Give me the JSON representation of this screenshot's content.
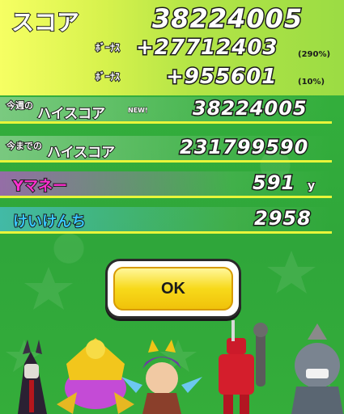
{
  "score": {
    "label": "スコア",
    "total": "38224005",
    "bonus1_label": "ﾎﾞｰﾅｽ",
    "bonus1_value": "+27712403",
    "bonus1_pct": "(290%)",
    "bonus2_label": "ﾎﾞｰﾅｽ",
    "bonus2_value": "+955601",
    "bonus2_pct": "(10%)"
  },
  "weekly_high": {
    "label_prefix": "今週の",
    "label": "ハイスコア",
    "badge": "NEW!",
    "value": "38224005"
  },
  "alltime_high": {
    "label_prefix": "今までの",
    "label": "ハイスコア",
    "value": "231799590"
  },
  "ymoney": {
    "label": "Yマネー",
    "value": "591",
    "unit": "y"
  },
  "exp": {
    "label": "けいけんち",
    "value": "2958"
  },
  "ok_button": {
    "label": "OK"
  },
  "colors": {
    "background": "#34ad3a",
    "accent_yellow": "#f7d91a",
    "ymoney_label": "#ff2fd0",
    "exp_label": "#37c8ff"
  }
}
